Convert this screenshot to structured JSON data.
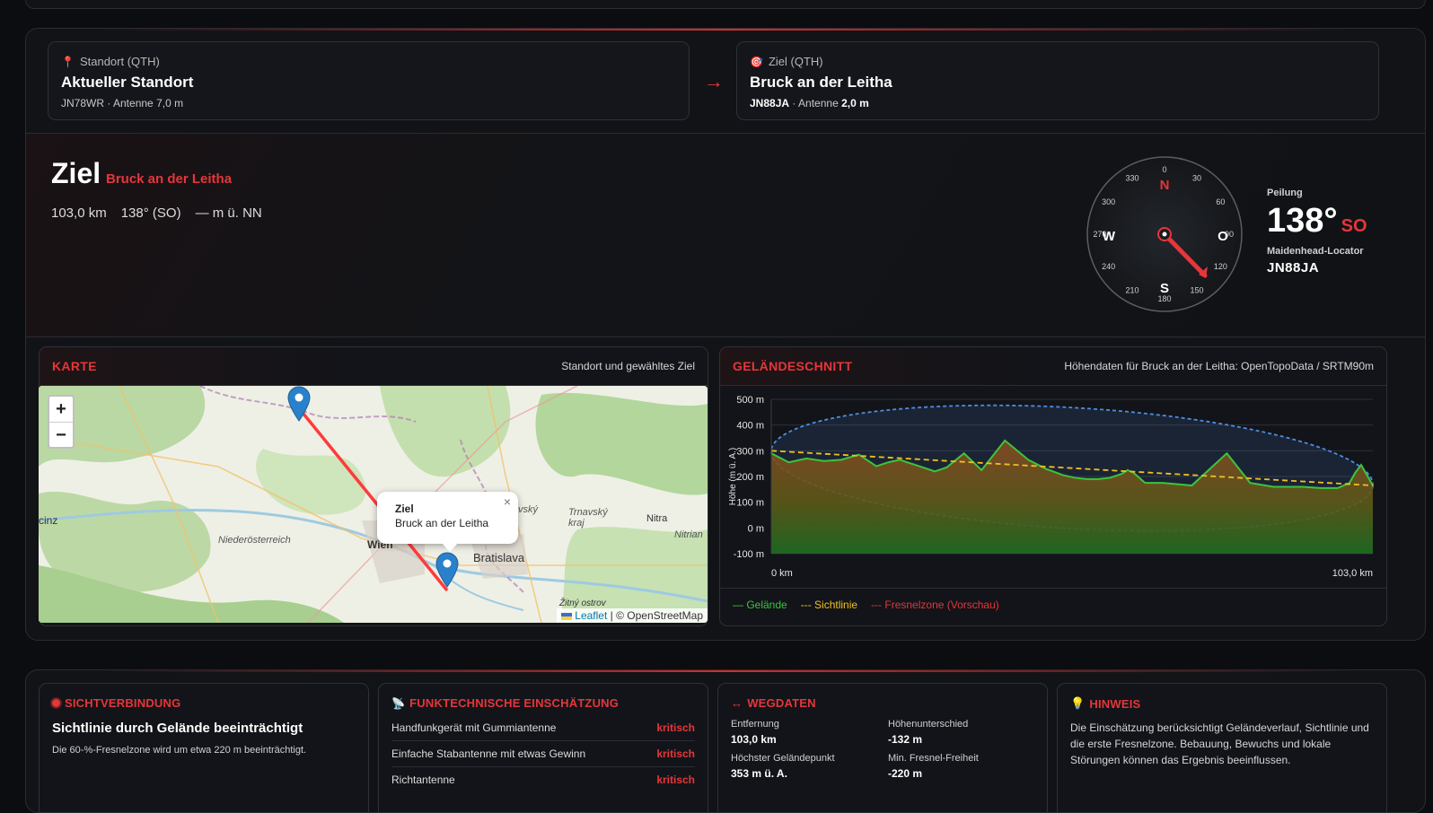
{
  "qth_from": {
    "label": "Standort (QTH)",
    "title": "Aktueller Standort",
    "sub_prefix": "JN78WR · Antenne ",
    "sub_value": "7,0 m"
  },
  "qth_arrow": "→",
  "qth_to": {
    "label": "Ziel (QTH)",
    "title": "Bruck an der Leitha",
    "locator": "JN88JA",
    "sub_prefix": " · Antenne ",
    "sub_value": "2,0 m"
  },
  "hero": {
    "title": "Ziel",
    "subtitle": "Bruck an der Leitha",
    "distance": "103,0 km",
    "bearing": "138° (SO)",
    "elevation": "— m ü. NN"
  },
  "compass": {
    "n": "N",
    "o": "O",
    "s": "S",
    "w": "W",
    "ticks": [
      "0",
      "30",
      "60",
      "90",
      "120",
      "150",
      "180",
      "210",
      "240",
      "270",
      "300",
      "330"
    ]
  },
  "peilung": {
    "label": "Peilung",
    "value": "138°",
    "dir": "SO",
    "locator_label": "Maidenhead-Locator",
    "locator": "JN88JA"
  },
  "karte": {
    "title": "KARTE",
    "subtitle": "Standort und gewähltes Ziel",
    "zoom_in": "+",
    "zoom_out": "−",
    "popup_title": "Ziel",
    "popup_sub": "Bruck an der Leitha",
    "popup_close": "×",
    "labels": {
      "niederoesterreich": "Niederösterreich",
      "wien": "Wien",
      "bratislava": "Bratislava",
      "nitra": "Nitra",
      "trnavsky": "Trnavský kraj",
      "nitrian": "Nitrian",
      "zitny": "Žitný ostrov",
      "cinz": "cinz",
      "vsky": "vský"
    },
    "attribution_leaflet": "Leaflet",
    "attribution_rest": " | © OpenStreetMap"
  },
  "gelaende": {
    "title": "GELÄNDESCHNITT",
    "subtitle": "Höhendaten für Bruck an der Leitha: OpenTopoData / SRTM90m",
    "legend": {
      "terrain": "— Gelände",
      "los": "--- Sichtlinie",
      "fresnel": "--- Fresnelzone (Vorschau)"
    },
    "colors": {
      "terrain": "#3cc43c",
      "los": "#f0c020",
      "fresnel": "#e5363a"
    }
  },
  "chart_data": {
    "type": "area",
    "ylabel": "Höhe (m ü. A.)",
    "ylim": [
      -100,
      500
    ],
    "yticks": [
      "500 m",
      "400 m",
      "300 m",
      "200 m",
      "100 m",
      "0 m",
      "-100 m"
    ],
    "xlabels": [
      "0 km",
      "103,0 km"
    ],
    "xlim": [
      0,
      103
    ],
    "series": [
      {
        "name": "Gelände",
        "x": [
          0,
          3,
          6,
          9,
          12,
          15,
          18,
          20,
          22,
          24,
          26,
          28,
          30,
          33,
          36,
          40,
          44,
          47,
          50,
          52,
          54,
          56,
          58,
          60,
          61,
          62,
          63,
          64,
          67,
          72,
          78,
          82,
          86,
          88,
          89,
          91,
          94,
          97,
          99,
          100,
          101,
          103
        ],
        "y": [
          290,
          255,
          270,
          260,
          265,
          285,
          240,
          255,
          265,
          250,
          235,
          220,
          235,
          290,
          225,
          340,
          265,
          230,
          205,
          195,
          190,
          190,
          195,
          210,
          225,
          215,
          195,
          175,
          175,
          165,
          290,
          175,
          160,
          160,
          160,
          160,
          155,
          155,
          175,
          215,
          245,
          165
        ]
      },
      {
        "name": "Sichtlinie",
        "x": [
          0,
          103
        ],
        "y": [
          300,
          165
        ]
      },
      {
        "name": "Fresnelzone (Vorschau)",
        "x": [
          0,
          51.5,
          103
        ],
        "y_upper": [
          300,
          460,
          165
        ],
        "y_lower": [
          300,
          -10,
          165
        ]
      }
    ]
  },
  "sicht": {
    "title": "SICHTVERBINDUNG",
    "headline": "Sichtlinie durch Gelände beeinträchtigt",
    "text": "Die 60-%-Fresnelzone wird um etwa 220 m beeinträchtigt."
  },
  "funk": {
    "title": "FUNKTECHNISCHE EINSCHÄTZUNG",
    "rows": [
      {
        "label": "Handfunkgerät mit Gummiantenne",
        "value": "kritisch"
      },
      {
        "label": "Einfache Stabantenne mit etwas Gewinn",
        "value": "kritisch"
      },
      {
        "label": "Richtantenne",
        "value": "kritisch"
      }
    ]
  },
  "weg": {
    "title": "WEGDATEN",
    "entfernung_label": "Entfernung",
    "entfernung": "103,0 km",
    "hoehe_label": "Höhenunterschied",
    "hoehe": "-132 m",
    "hoechst_label": "Höchster Geländepunkt",
    "hoechst": "353 m ü. A.",
    "fresnel_label": "Min. Fresnel-Freiheit",
    "fresnel": "-220 m"
  },
  "hinweis": {
    "title": "HINWEIS",
    "text": "Die Einschätzung berücksichtigt Geländeverlauf, Sichtlinie und die erste Fresnelzone. Bebauung, Bewuchs und lokale Störungen können das Ergebnis beeinflussen."
  }
}
